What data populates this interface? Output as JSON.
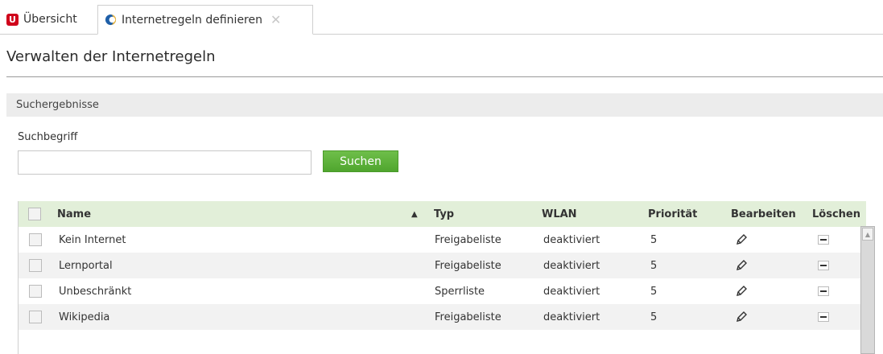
{
  "tabs": [
    {
      "label": "Übersicht",
      "icon": "brand-u-icon"
    },
    {
      "label": "Internetregeln definieren",
      "icon": "globe-icon",
      "close": "✕"
    }
  ],
  "page_title": "Verwalten der Internetregeln",
  "section_header": "Suchergebnisse",
  "search": {
    "label": "Suchbegriff",
    "value": "",
    "button_label": "Suchen"
  },
  "table": {
    "columns": {
      "name": "Name",
      "sort_indicator": "▲",
      "type": "Typ",
      "wlan": "WLAN",
      "priority": "Priorität",
      "edit": "Bearbeiten",
      "delete": "Löschen"
    },
    "rows": [
      {
        "name": "Kein Internet",
        "type": "Freigabeliste",
        "wlan": "deaktiviert",
        "priority": "5"
      },
      {
        "name": "Lernportal",
        "type": "Freigabeliste",
        "wlan": "deaktiviert",
        "priority": "5"
      },
      {
        "name": "Unbeschränkt",
        "type": "Sperrliste",
        "wlan": "deaktiviert",
        "priority": "5"
      },
      {
        "name": "Wikipedia",
        "type": "Freigabeliste",
        "wlan": "deaktiviert",
        "priority": "5"
      }
    ]
  },
  "colors": {
    "brand_red": "#d0021b",
    "button_green": "#5cb338",
    "table_header_bg": "#e2efd9"
  }
}
